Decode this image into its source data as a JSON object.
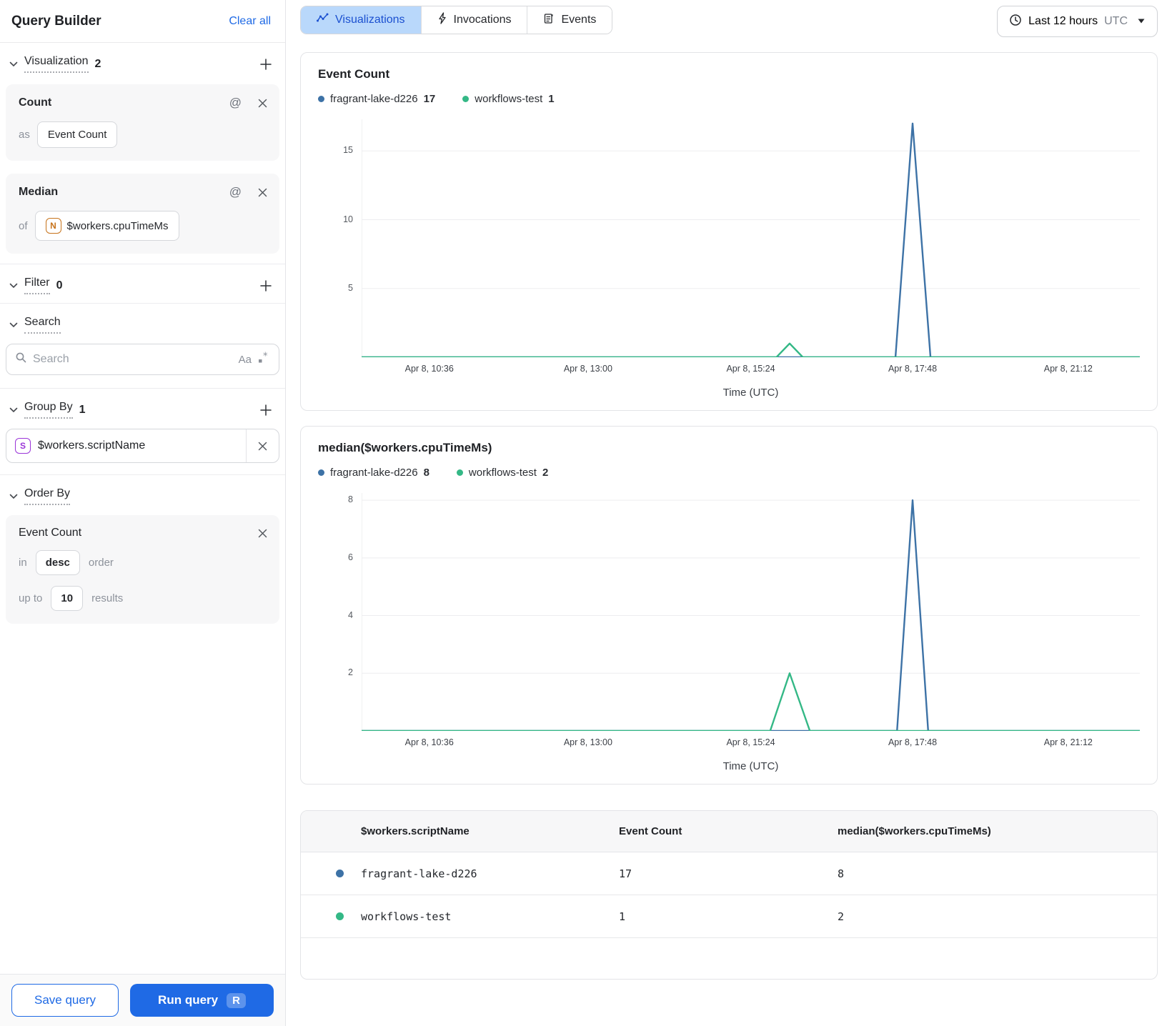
{
  "sidebar": {
    "title": "Query Builder",
    "clear_all": "Clear all",
    "visualization": {
      "label": "Visualization",
      "count": "2",
      "cards": [
        {
          "title": "Count",
          "prefix": "as",
          "value": "Event Count"
        },
        {
          "title": "Median",
          "prefix": "of",
          "field_icon": "N",
          "value": "$workers.cpuTimeMs"
        }
      ]
    },
    "filter": {
      "label": "Filter",
      "count": "0"
    },
    "search": {
      "label": "Search",
      "placeholder": "Search",
      "match_case_icon": "Aa",
      "regex_icon": ".*"
    },
    "group_by": {
      "label": "Group By",
      "count": "1",
      "field_icon": "S",
      "value": "$workers.scriptName"
    },
    "order_by": {
      "label": "Order By",
      "card": {
        "title": "Event Count",
        "in_label": "in",
        "direction": "desc",
        "order_label": "order",
        "up_to_label": "up to",
        "limit": "10",
        "results_label": "results"
      }
    },
    "save_button": "Save query",
    "run_button": "Run query",
    "run_shortcut": "R"
  },
  "tabs": [
    {
      "label": "Visualizations",
      "icon": "line-chart-icon",
      "active": true
    },
    {
      "label": "Invocations",
      "icon": "lightning-icon",
      "active": false
    },
    {
      "label": "Events",
      "icon": "events-doc-icon",
      "active": false
    }
  ],
  "time_range": {
    "label": "Last 12 hours",
    "timezone": "UTC"
  },
  "colors": {
    "accent_blue": "#1f6ae5",
    "series_blue": "#3d72a6",
    "series_green": "#34b886"
  },
  "chart_data": [
    {
      "type": "line",
      "title": "Event Count",
      "xlabel": "Time (UTC)",
      "x_ticks": [
        "Apr 8, 10:36",
        "Apr 8, 13:00",
        "Apr 8, 15:24",
        "Apr 8, 17:48",
        "Apr 8, 21:12"
      ],
      "x_tick_pos": [
        0.087,
        0.291,
        0.5,
        0.708,
        0.908
      ],
      "y_ticks": [
        5,
        10,
        15
      ],
      "ylim": [
        0,
        17.3
      ],
      "grid": true,
      "legend_position": "top",
      "legend": [
        {
          "name": "fragrant-lake-d226",
          "value": "17",
          "color": "#3d72a6"
        },
        {
          "name": "workflows-test",
          "value": "1",
          "color": "#34b886"
        }
      ],
      "series": [
        {
          "name": "fragrant-lake-d226",
          "color": "#3d72a6",
          "points": [
            [
              0,
              0
            ],
            [
              0.686,
              0
            ],
            [
              0.708,
              17
            ],
            [
              0.731,
              0
            ],
            [
              1,
              0
            ]
          ]
        },
        {
          "name": "workflows-test",
          "color": "#34b886",
          "points": [
            [
              0,
              0
            ],
            [
              0.533,
              0
            ],
            [
              0.55,
              1
            ],
            [
              0.567,
              0
            ],
            [
              1,
              0
            ]
          ]
        }
      ]
    },
    {
      "type": "line",
      "title": "median($workers.cpuTimeMs)",
      "xlabel": "Time (UTC)",
      "x_ticks": [
        "Apr 8, 10:36",
        "Apr 8, 13:00",
        "Apr 8, 15:24",
        "Apr 8, 17:48",
        "Apr 8, 21:12"
      ],
      "x_tick_pos": [
        0.087,
        0.291,
        0.5,
        0.708,
        0.908
      ],
      "y_ticks": [
        2,
        4,
        6,
        8
      ],
      "ylim": [
        0,
        8.25
      ],
      "grid": true,
      "legend_position": "top",
      "legend": [
        {
          "name": "fragrant-lake-d226",
          "value": "8",
          "color": "#3d72a6"
        },
        {
          "name": "workflows-test",
          "value": "2",
          "color": "#34b886"
        }
      ],
      "series": [
        {
          "name": "fragrant-lake-d226",
          "color": "#3d72a6",
          "points": [
            [
              0,
              0
            ],
            [
              0.688,
              0
            ],
            [
              0.708,
              8
            ],
            [
              0.728,
              0
            ],
            [
              1,
              0
            ]
          ]
        },
        {
          "name": "workflows-test",
          "color": "#34b886",
          "points": [
            [
              0,
              0
            ],
            [
              0.525,
              0
            ],
            [
              0.55,
              2
            ],
            [
              0.576,
              0
            ],
            [
              1,
              0
            ]
          ]
        }
      ]
    }
  ],
  "table": {
    "columns": [
      "$workers.scriptName",
      "Event Count",
      "median($workers.cpuTimeMs)"
    ],
    "rows": [
      {
        "color": "#3d72a6",
        "cells": [
          "fragrant-lake-d226",
          "17",
          "8"
        ]
      },
      {
        "color": "#34b886",
        "cells": [
          "workflows-test",
          "1",
          "2"
        ]
      }
    ]
  }
}
